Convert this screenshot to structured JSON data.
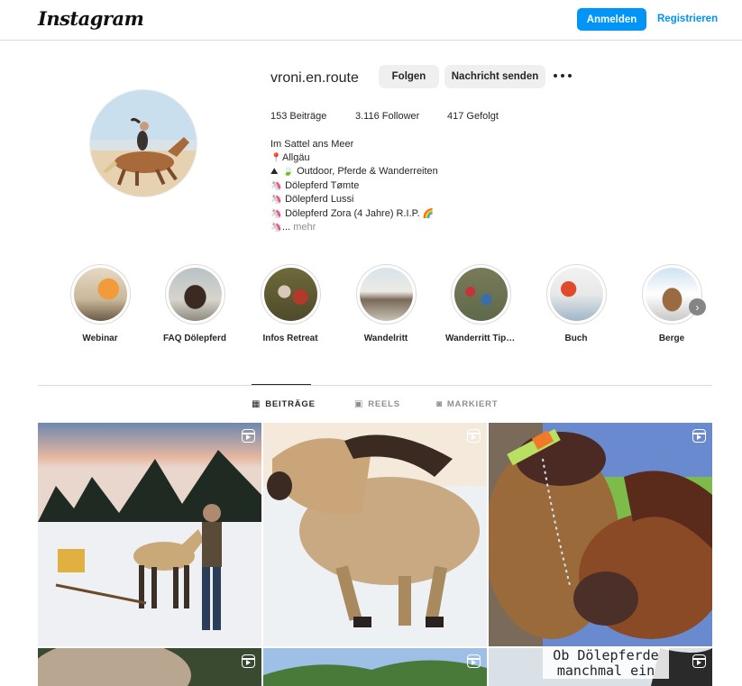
{
  "nav": {
    "logo": "Instagram",
    "login_label": "Anmelden",
    "register_label": "Registrieren"
  },
  "profile": {
    "username": "vroni.en.route",
    "follow_label": "Folgen",
    "message_label": "Nachricht senden",
    "stats": {
      "posts": "153 Beiträge",
      "followers": "3.116 Follower",
      "following": "417 Gefolgt"
    },
    "bio": {
      "name": "Im Sattel ans Meer",
      "location": "Allgäu",
      "line2": "Outdoor, Pferde & Wanderreiten",
      "line3": "Dölepferd Tømte",
      "line4": "Dölepferd Lussi",
      "line5": "Dölepferd Zora (4 Jahre) R.I.P.",
      "line6": "...",
      "more": "mehr"
    }
  },
  "highlights": [
    {
      "label": "Webinar"
    },
    {
      "label": "FAQ Dölepferd"
    },
    {
      "label": "Infos Retreat"
    },
    {
      "label": "Wandelritt"
    },
    {
      "label": "Wanderritt Tipps"
    },
    {
      "label": "Buch"
    },
    {
      "label": "Berge"
    }
  ],
  "tabs": [
    {
      "label": "BEITRÄGE",
      "active": true
    },
    {
      "label": "REELS",
      "active": false
    },
    {
      "label": "MARKIERT",
      "active": false
    }
  ],
  "posts": {
    "p6_text": "Ob Dölepferde manchmal ein"
  },
  "colors": {
    "accent": "#0095f6",
    "muted": "#8e8e8e",
    "border": "#dbdbdb"
  }
}
